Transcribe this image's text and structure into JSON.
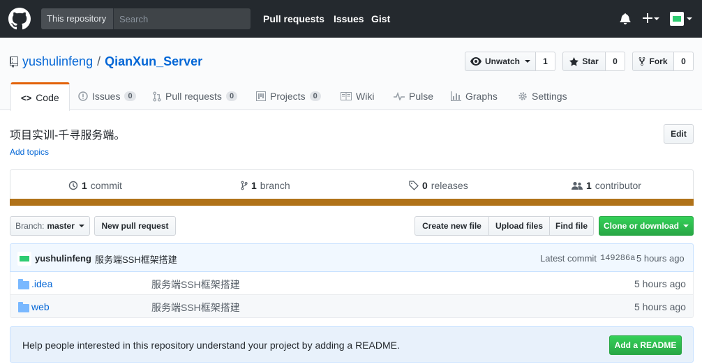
{
  "header": {
    "scope_label": "This repository",
    "search_placeholder": "Search",
    "nav": [
      "Pull requests",
      "Issues",
      "Gist"
    ]
  },
  "repo": {
    "owner": "yushulinfeng",
    "separator": "/",
    "name": "QianXun_Server",
    "unwatch_label": "Unwatch",
    "watch_count": "1",
    "star_label": "Star",
    "star_count": "0",
    "fork_label": "Fork",
    "fork_count": "0"
  },
  "tabs": [
    {
      "label": "Code"
    },
    {
      "label": "Issues",
      "count": "0"
    },
    {
      "label": "Pull requests",
      "count": "0"
    },
    {
      "label": "Projects",
      "count": "0"
    },
    {
      "label": "Wiki"
    },
    {
      "label": "Pulse"
    },
    {
      "label": "Graphs"
    },
    {
      "label": "Settings"
    }
  ],
  "description": "项目实训-千寻服务端。",
  "add_topics": "Add topics",
  "edit_label": "Edit",
  "summary": {
    "commits_num": "1",
    "commits_label": "commit",
    "branches_num": "1",
    "branches_label": "branch",
    "releases_num": "0",
    "releases_label": "releases",
    "contributors_num": "1",
    "contributors_label": "contributor",
    "lang_color": "#b07219"
  },
  "file_nav": {
    "branch_prefix": "Branch:",
    "branch_name": "master",
    "new_pr": "New pull request",
    "create_file": "Create new file",
    "upload_files": "Upload files",
    "find_file": "Find file",
    "clone": "Clone or download"
  },
  "commit": {
    "author": "yushulinfeng",
    "message": "服务端SSH框架搭建",
    "latest_label": "Latest commit",
    "sha": "149286a",
    "age": "5 hours ago"
  },
  "files": [
    {
      "name": ".idea",
      "message": "服务端SSH框架搭建",
      "age": "5 hours ago"
    },
    {
      "name": "web",
      "message": "服务端SSH框架搭建",
      "age": "5 hours ago"
    }
  ],
  "readme_prompt": {
    "text": "Help people interested in this repository understand your project by adding a README.",
    "button": "Add a README"
  },
  "colors": {
    "accent": "#0366d6",
    "header_bg": "#24292e",
    "green": "#28a745",
    "tab_underline": "#e36209"
  }
}
